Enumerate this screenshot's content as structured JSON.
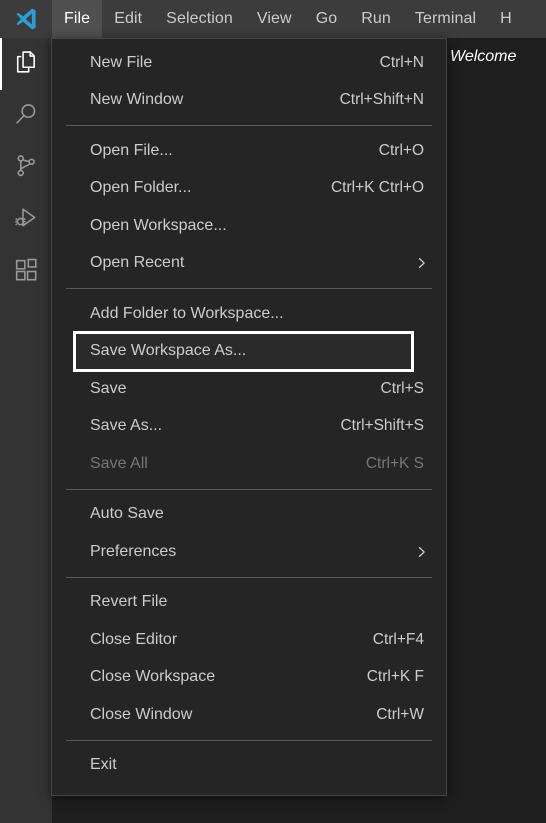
{
  "window": {
    "app": "Visual Studio Code",
    "logo_icon": "vscode-logo-icon"
  },
  "menubar": {
    "items": [
      {
        "label": "File",
        "active": true
      },
      {
        "label": "Edit",
        "active": false
      },
      {
        "label": "Selection",
        "active": false
      },
      {
        "label": "View",
        "active": false
      },
      {
        "label": "Go",
        "active": false
      },
      {
        "label": "Run",
        "active": false
      },
      {
        "label": "Terminal",
        "active": false
      },
      {
        "label": "H",
        "active": false
      }
    ]
  },
  "activitybar": {
    "items": [
      {
        "name": "explorer",
        "icon": "files-icon",
        "active": true
      },
      {
        "name": "search",
        "icon": "search-icon",
        "active": false
      },
      {
        "name": "source-control",
        "icon": "source-control-branch-icon",
        "active": false
      },
      {
        "name": "run-and-debug",
        "icon": "run-debug-play-bug-icon",
        "active": false
      },
      {
        "name": "extensions",
        "icon": "extensions-blocks-icon",
        "active": false
      }
    ]
  },
  "editor": {
    "tabs": [
      {
        "label": "Welcome",
        "active": true,
        "italic": true
      }
    ]
  },
  "file_menu": {
    "title": "File",
    "groups": [
      {
        "items": [
          {
            "label": "New File",
            "accel": "Ctrl+N",
            "disabled": false,
            "submenu": false,
            "focused": false
          },
          {
            "label": "New Window",
            "accel": "Ctrl+Shift+N",
            "disabled": false,
            "submenu": false,
            "focused": false
          }
        ]
      },
      {
        "items": [
          {
            "label": "Open File...",
            "accel": "Ctrl+O",
            "disabled": false,
            "submenu": false,
            "focused": false
          },
          {
            "label": "Open Folder...",
            "accel": "Ctrl+K Ctrl+O",
            "disabled": false,
            "submenu": false,
            "focused": false
          },
          {
            "label": "Open Workspace...",
            "accel": "",
            "disabled": false,
            "submenu": false,
            "focused": false
          },
          {
            "label": "Open Recent",
            "accel": "",
            "disabled": false,
            "submenu": true,
            "focused": false
          }
        ]
      },
      {
        "items": [
          {
            "label": "Add Folder to Workspace...",
            "accel": "",
            "disabled": false,
            "submenu": false,
            "focused": false
          },
          {
            "label": "Save Workspace As...",
            "accel": "",
            "disabled": false,
            "submenu": false,
            "focused": true
          },
          {
            "label": "Save",
            "accel": "Ctrl+S",
            "disabled": false,
            "submenu": false,
            "focused": false
          },
          {
            "label": "Save As...",
            "accel": "Ctrl+Shift+S",
            "disabled": false,
            "submenu": false,
            "focused": false
          },
          {
            "label": "Save All",
            "accel": "Ctrl+K S",
            "disabled": true,
            "submenu": false,
            "focused": false
          }
        ]
      },
      {
        "items": [
          {
            "label": "Auto Save",
            "accel": "",
            "disabled": false,
            "submenu": false,
            "focused": false
          },
          {
            "label": "Preferences",
            "accel": "",
            "disabled": false,
            "submenu": true,
            "focused": false
          }
        ]
      },
      {
        "items": [
          {
            "label": "Revert File",
            "accel": "",
            "disabled": false,
            "submenu": false,
            "focused": false
          },
          {
            "label": "Close Editor",
            "accel": "Ctrl+F4",
            "disabled": false,
            "submenu": false,
            "focused": false
          },
          {
            "label": "Close Workspace",
            "accel": "Ctrl+K F",
            "disabled": false,
            "submenu": false,
            "focused": false
          },
          {
            "label": "Close Window",
            "accel": "Ctrl+W",
            "disabled": false,
            "submenu": false,
            "focused": false
          }
        ]
      },
      {
        "items": [
          {
            "label": "Exit",
            "accel": "",
            "disabled": false,
            "submenu": false,
            "focused": false
          }
        ]
      }
    ]
  },
  "colors": {
    "titlebar_bg": "#3c3c3c",
    "menu_active_bg": "#505050",
    "activitybar_bg": "#333333",
    "editor_bg": "#1e1e1e",
    "tabbar_bg": "#252526",
    "dropdown_bg": "#252526",
    "dropdown_border": "#454545",
    "text": "#cccccc",
    "text_disabled": "#777777",
    "separator": "#5a5a5a",
    "focus_outline": "#ffffff",
    "logo_blue": "#29b6f6"
  }
}
